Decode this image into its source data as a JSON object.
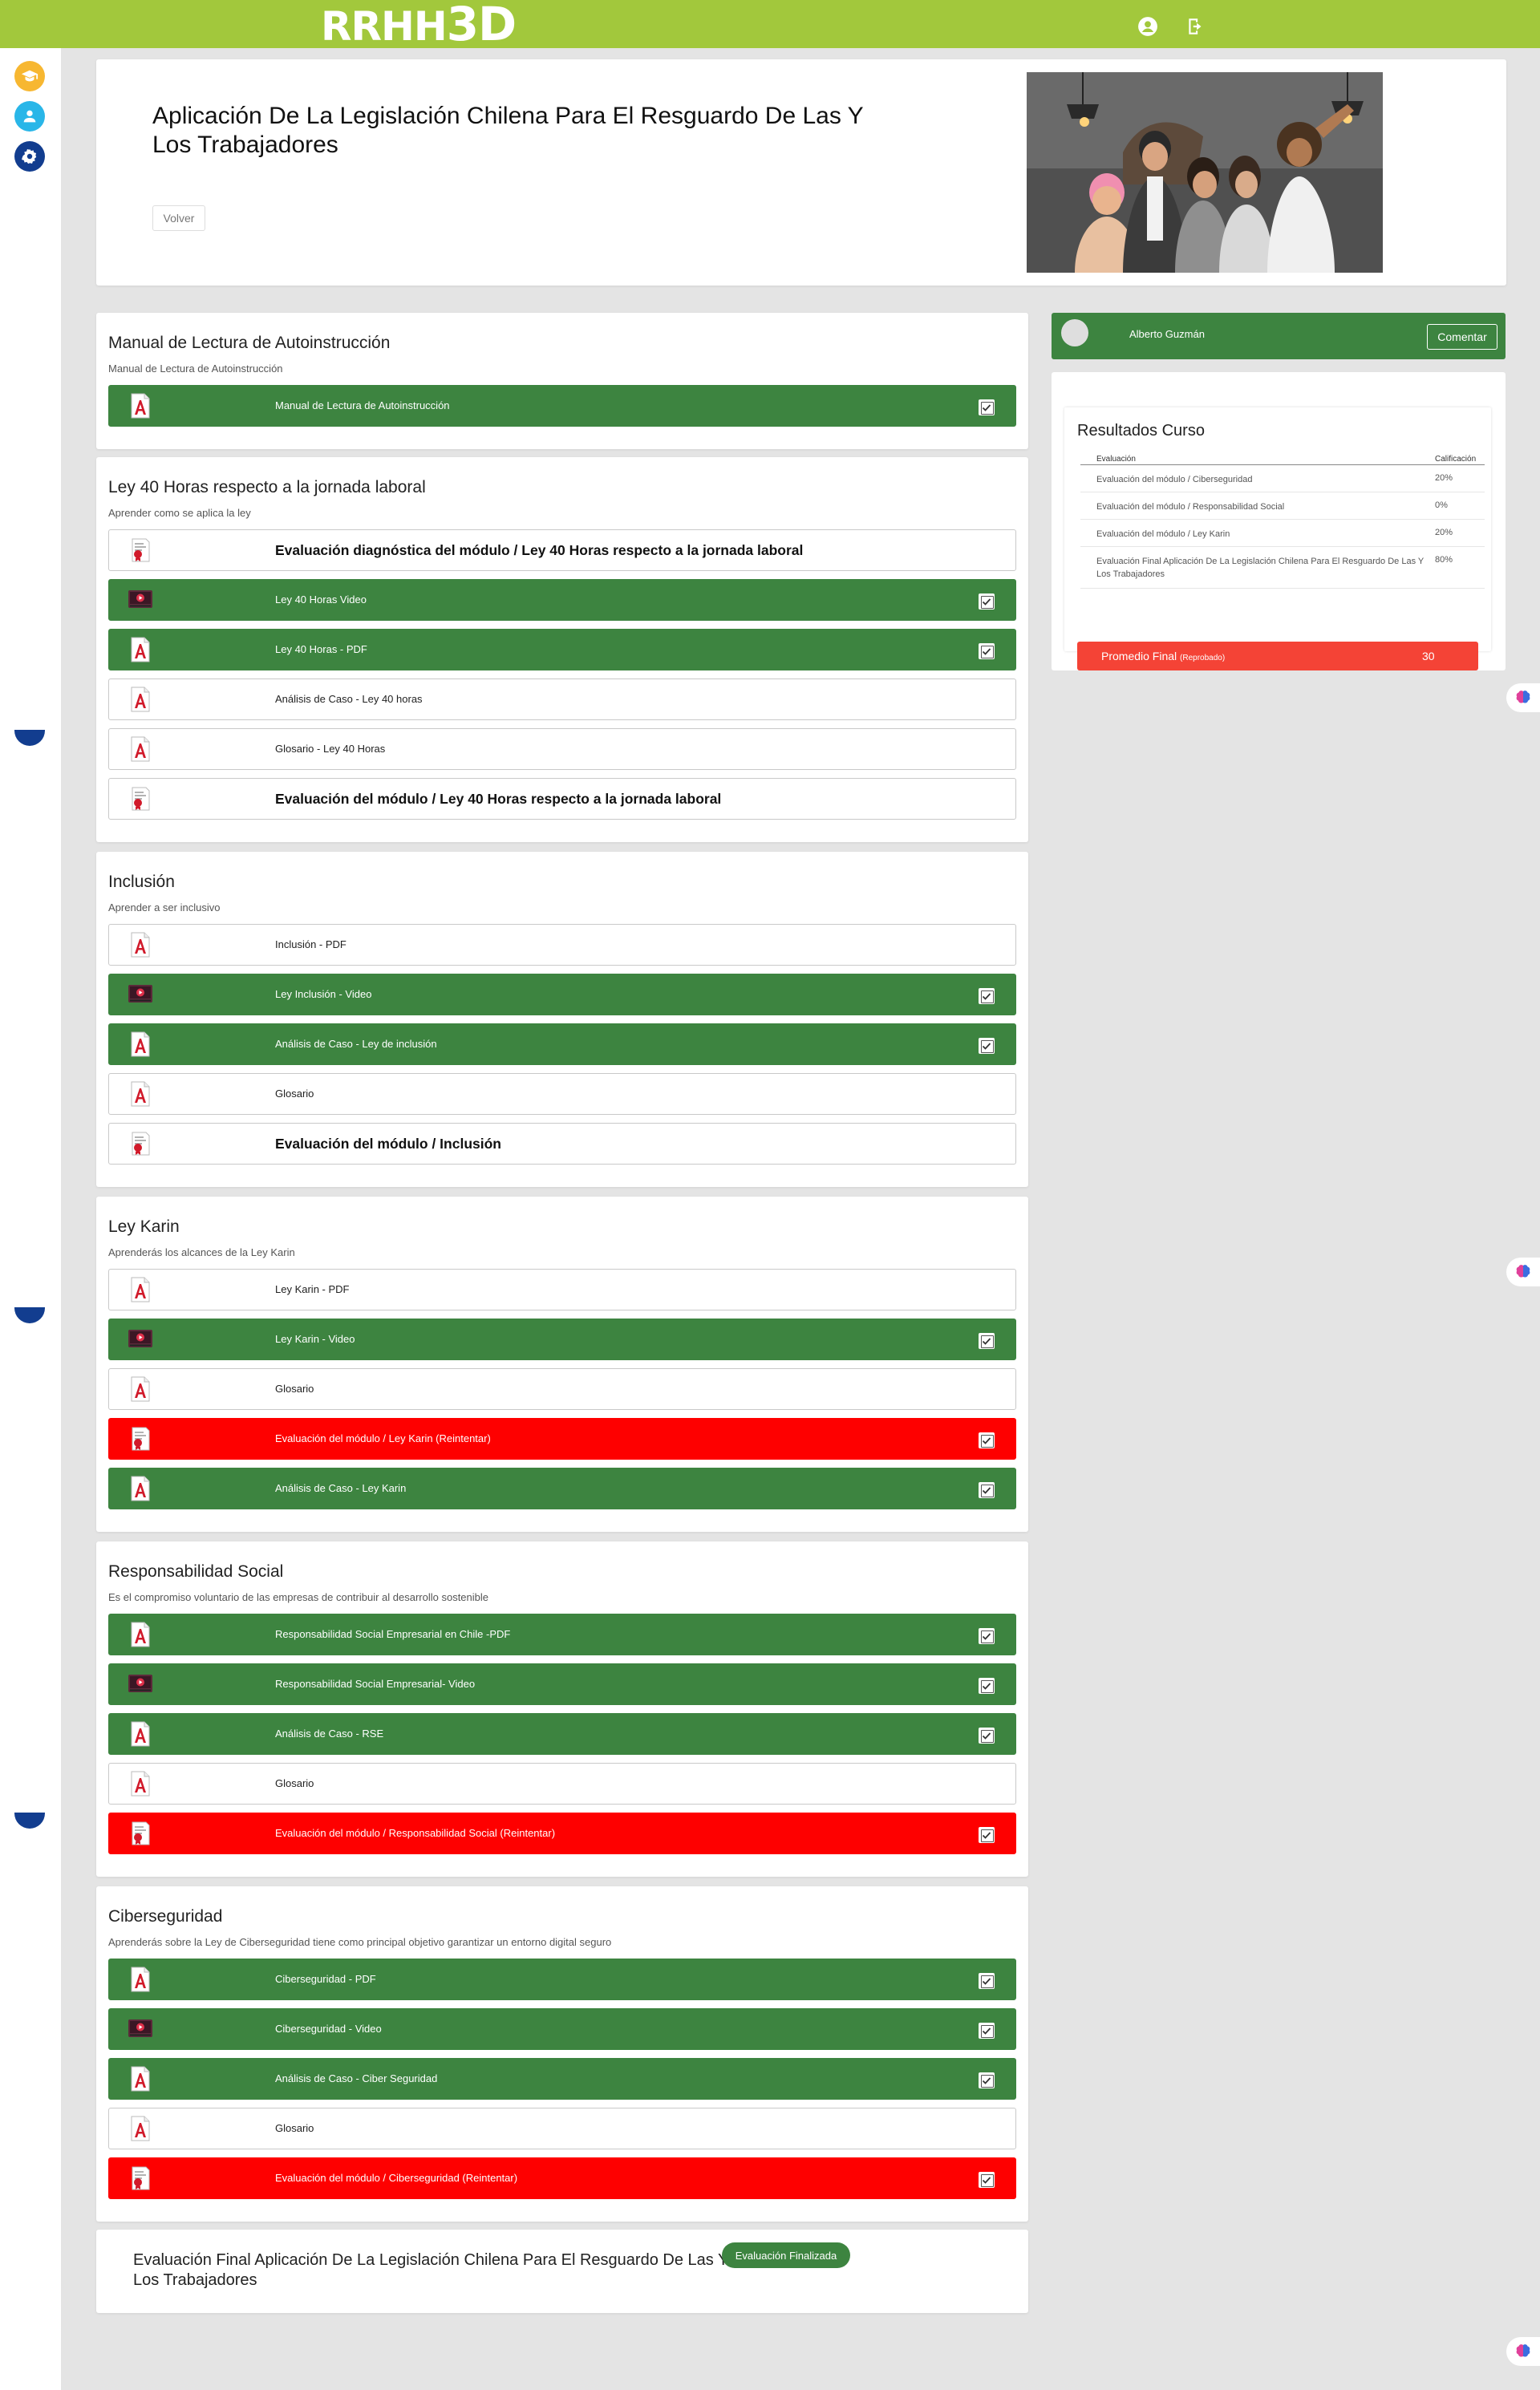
{
  "header": {
    "logo_text": "RRHH",
    "logo_number": "3D",
    "profile_icon": "user-circle-icon",
    "logout_icon": "logout-icon"
  },
  "sidebar": {
    "items": [
      {
        "name": "courses",
        "icon": "graduation-cap-icon",
        "color": "#f7b731"
      },
      {
        "name": "profile",
        "icon": "user-icon",
        "color": "#29b6e8"
      },
      {
        "name": "settings",
        "icon": "gear-icon",
        "color": "#123d8f"
      }
    ]
  },
  "course": {
    "title": "Aplicación De La Legislación Chilena Para El Resguardo De Las Y Los Trabajadores",
    "back_label": "Volver"
  },
  "modules": [
    {
      "title": "Manual de Lectura de Autoinstrucción",
      "description": "Manual de Lectura de Autoinstrucción",
      "items": [
        {
          "label": "Manual de Lectura de Autoinstrucción",
          "type": "pdf",
          "state": "done"
        }
      ]
    },
    {
      "title": "Ley 40 Horas respecto a la jornada laboral",
      "description": "Aprender como se aplica la ley",
      "items": [
        {
          "label": "Evaluación diagnóstica del módulo / Ley 40 Horas respecto a la jornada laboral",
          "type": "eval",
          "state": "pending"
        },
        {
          "label": "Ley 40 Horas Video",
          "type": "video",
          "state": "done"
        },
        {
          "label": "Ley 40 Horas - PDF",
          "type": "pdf",
          "state": "done"
        },
        {
          "label": "Análisis de Caso - Ley 40 horas",
          "type": "pdf",
          "state": "pending"
        },
        {
          "label": "Glosario - Ley 40 Horas",
          "type": "pdf",
          "state": "pending"
        },
        {
          "label": "Evaluación del módulo / Ley 40 Horas respecto a la jornada laboral",
          "type": "eval",
          "state": "pending"
        }
      ]
    },
    {
      "title": "Inclusión",
      "description": "Aprender a ser inclusivo",
      "items": [
        {
          "label": "Inclusión - PDF",
          "type": "pdf",
          "state": "pending"
        },
        {
          "label": "Ley Inclusión - Video",
          "type": "video",
          "state": "done"
        },
        {
          "label": "Análisis de Caso - Ley de inclusión",
          "type": "pdf",
          "state": "done"
        },
        {
          "label": "Glosario",
          "type": "pdf",
          "state": "pending"
        },
        {
          "label": "Evaluación del módulo / Inclusión",
          "type": "eval",
          "state": "pending"
        }
      ]
    },
    {
      "title": "Ley Karin",
      "description": "Aprenderás los alcances de la Ley Karin",
      "items": [
        {
          "label": "Ley Karin - PDF",
          "type": "pdf",
          "state": "pending"
        },
        {
          "label": "Ley Karin - Video",
          "type": "video",
          "state": "done"
        },
        {
          "label": "Glosario",
          "type": "pdf",
          "state": "pending"
        },
        {
          "label": "Evaluación del módulo / Ley Karin (Reintentar)",
          "type": "eval",
          "state": "failed"
        },
        {
          "label": "Análisis de Caso - Ley Karin",
          "type": "pdf",
          "state": "done"
        }
      ]
    },
    {
      "title": "Responsabilidad Social",
      "description": "Es el compromiso voluntario de las empresas de contribuir al desarrollo sostenible",
      "items": [
        {
          "label": "Responsabilidad Social Empresarial en Chile -PDF",
          "type": "pdf",
          "state": "done"
        },
        {
          "label": "Responsabilidad Social Empresarial- Video",
          "type": "video",
          "state": "done"
        },
        {
          "label": "Análisis de Caso - RSE",
          "type": "pdf",
          "state": "done"
        },
        {
          "label": "Glosario",
          "type": "pdf",
          "state": "pending"
        },
        {
          "label": "Evaluación del módulo / Responsabilidad Social (Reintentar)",
          "type": "eval",
          "state": "failed"
        }
      ]
    },
    {
      "title": "Ciberseguridad",
      "description": "Aprenderás sobre la Ley de Ciberseguridad tiene como principal objetivo garantizar un entorno digital seguro",
      "items": [
        {
          "label": "Ciberseguridad - PDF",
          "type": "pdf",
          "state": "done"
        },
        {
          "label": "Ciberseguridad - Video",
          "type": "video",
          "state": "done"
        },
        {
          "label": "Análisis de Caso - Ciber Seguridad",
          "type": "pdf",
          "state": "done"
        },
        {
          "label": "Glosario",
          "type": "pdf",
          "state": "pending"
        },
        {
          "label": "Evaluación del módulo / Ciberseguridad (Reintentar)",
          "type": "eval",
          "state": "failed"
        }
      ]
    }
  ],
  "final_eval": {
    "title": "Evaluación Final Aplicación De La Legislación Chilena Para El Resguardo De Las Y Los Trabajadores",
    "badge": "Evaluación Finalizada"
  },
  "user": {
    "name": "Alberto Guzmán",
    "comment_label": "Comentar"
  },
  "results": {
    "title": "Resultados Curso",
    "col_eval": "Evaluación",
    "col_grade": "Calificación",
    "rows": [
      {
        "name": "Evaluación del módulo / Ciberseguridad",
        "grade": "20%"
      },
      {
        "name": "Evaluación del módulo / Responsabilidad Social",
        "grade": "0%"
      },
      {
        "name": "Evaluación del módulo / Ley Karin",
        "grade": "20%"
      },
      {
        "name": "Evaluación Final Aplicación De La Legislación Chilena Para El Resguardo De Las Y Los Trabajadores",
        "grade": "80%"
      }
    ],
    "average_label": "Promedio Final",
    "average_status": "(Reprobado)",
    "average_value": "30"
  },
  "colors": {
    "topbar": "#a2c83c",
    "done": "#3d8440",
    "failed": "#fe0000",
    "average": "#f44336"
  },
  "floating": {
    "icon": "brain-icon"
  }
}
